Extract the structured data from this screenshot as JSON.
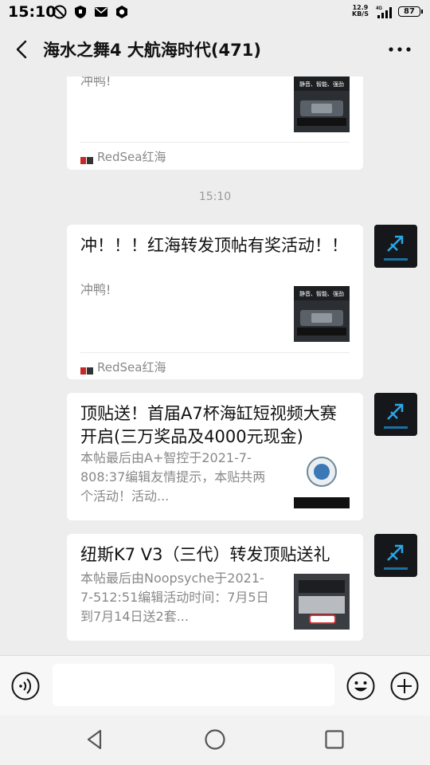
{
  "status_bar": {
    "time": "15:10",
    "net_speed_value": "12.9",
    "net_speed_unit": "KB/S",
    "network_type": "4G",
    "battery": "87"
  },
  "header": {
    "title": "海水之舞4 大航海时代(471)"
  },
  "messages": [
    {
      "desc": "冲鸭!",
      "source": "RedSea红海",
      "thumb_caption": "静音、智能、强劲"
    },
    {
      "timestamp": "15:10"
    },
    {
      "title": "冲！！！红海转发顶帖有奖活动！！",
      "desc": "冲鸭!",
      "source": "RedSea红海",
      "thumb_caption": "静音、智能、强劲"
    },
    {
      "title": "顶贴送！首届A7杯海缸短视频大赛开启(三万奖品及4000元现金)",
      "desc": "本帖最后由A+智控于2021-7-808:37编辑友情提示，本贴共两个活动！活动..."
    },
    {
      "title": "纽斯K7 V3（三代）转发顶贴送礼",
      "desc": "本帖最后由Noopsyche于2021-7-512:51编辑活动时间：7月5日到7月14日送2套..."
    }
  ],
  "colors": {
    "background": "#ededed",
    "card": "#ffffff",
    "secondary_text": "#888888"
  }
}
